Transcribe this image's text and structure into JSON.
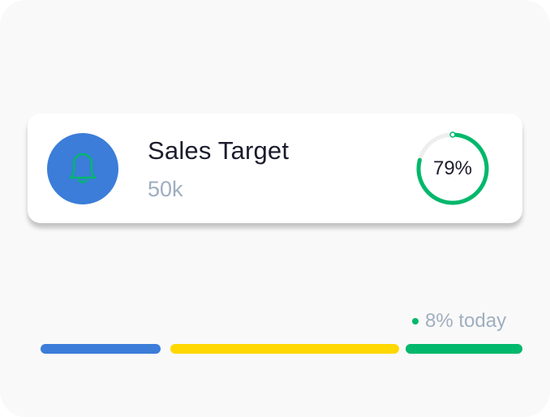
{
  "card": {
    "title": "Sales Target",
    "value": "50k",
    "progress_label": "79%",
    "progress": 0.79,
    "icon": "bell-icon"
  },
  "today": {
    "label": "8% today"
  },
  "bars": [
    {
      "name": "blue",
      "color": "#3b7dd8"
    },
    {
      "name": "yellow",
      "color": "#ffd800"
    },
    {
      "name": "green",
      "color": "#00b86b"
    }
  ],
  "colors": {
    "icon_bg": "#3b7dd8",
    "icon_stroke": "#00b86b",
    "ring_track": "#eeeeee",
    "ring_progress": "#00b86b",
    "today_dot": "#00b86b"
  }
}
